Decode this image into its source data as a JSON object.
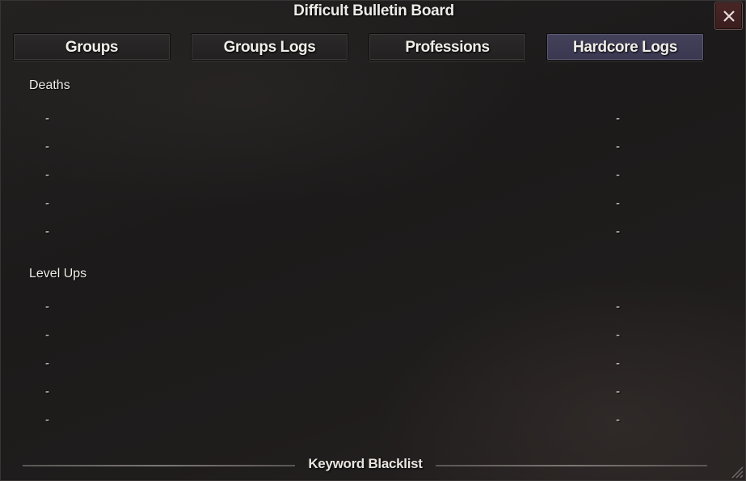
{
  "window": {
    "title": "Difficult Bulletin Board",
    "close_glyph": "×"
  },
  "tabs": [
    {
      "label": "Groups",
      "active": false
    },
    {
      "label": "Groups Logs",
      "active": false
    },
    {
      "label": "Professions",
      "active": false
    },
    {
      "label": "Hardcore Logs",
      "active": true
    }
  ],
  "deaths": {
    "title": "Deaths",
    "rows": [
      {
        "left": "-",
        "right": "-"
      },
      {
        "left": "-",
        "right": "-"
      },
      {
        "left": "-",
        "right": "-"
      },
      {
        "left": "-",
        "right": "-"
      },
      {
        "left": "-",
        "right": "-"
      }
    ]
  },
  "level_ups": {
    "title": "Level Ups",
    "rows": [
      {
        "left": "-",
        "right": "-"
      },
      {
        "left": "-",
        "right": "-"
      },
      {
        "left": "-",
        "right": "-"
      },
      {
        "left": "-",
        "right": "-"
      },
      {
        "left": "-",
        "right": "-"
      }
    ]
  },
  "footer": {
    "label": "Keyword Blacklist"
  },
  "colors": {
    "active_tab": "#44425a",
    "close_button": "#4a2626",
    "text": "#f0ede8"
  }
}
